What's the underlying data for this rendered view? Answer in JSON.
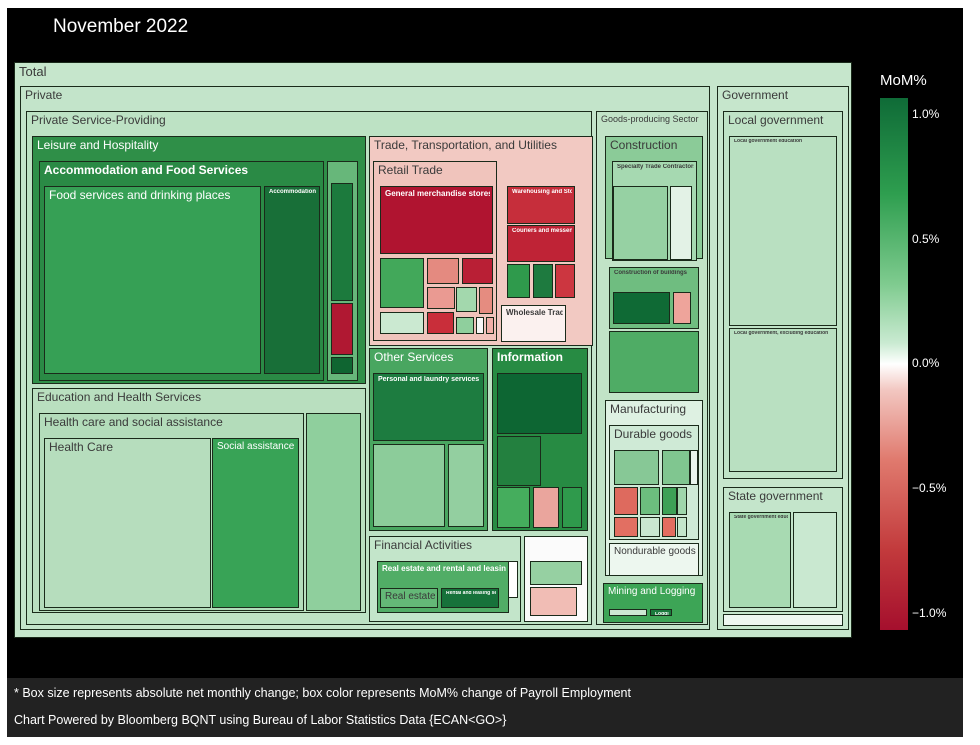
{
  "title": "November 2022",
  "colorbar": {
    "title": "MoM%",
    "ticks": [
      "1.0%",
      "0.5%",
      "0.0%",
      "−0.5%",
      "−1.0%"
    ]
  },
  "footer": {
    "line1": "* Box size represents absolute net monthly change; box color represents MoM% change of Payroll Employment",
    "line2": "Chart Powered by Bloomberg BQNT using Bureau of Labor Statistics Data {ECAN<GO>}"
  },
  "chart_data": {
    "type": "treemap",
    "size_measure": "absolute net monthly change",
    "color_measure": "MoM% change of Payroll Employment",
    "color_range": [
      -1.0,
      1.0
    ],
    "nodes": [
      {
        "label": "Total",
        "color": "#c6e6cc"
      },
      {
        "label": "Private",
        "color": "#c3e4ca"
      },
      {
        "label": "Private Service-Providing",
        "color": "#bde2c4"
      },
      {
        "label": "Leisure and Hospitality",
        "color": "#2f8f48"
      },
      {
        "label": "Accommodation and Food Services",
        "color": "#2a8a45"
      },
      {
        "label": "Food services and drinking places",
        "color": "#36a055"
      },
      {
        "label": "Accommodation",
        "color": "#186f38"
      },
      {
        "label": "",
        "color": "#67b77a"
      },
      {
        "label": "",
        "color": "#1c7a3d"
      },
      {
        "label": "",
        "color": "#b01832"
      },
      {
        "label": "",
        "color": "#0f6531"
      },
      {
        "label": "Education and Health Services",
        "color": "#b9dfbf"
      },
      {
        "label": "Health care and social assistance",
        "color": "#b3dcba"
      },
      {
        "label": "Health Care",
        "color": "#b6ddbd"
      },
      {
        "label": "Social assistance",
        "color": "#38a356"
      },
      {
        "label": "",
        "color": "#8fcf9d"
      },
      {
        "label": "Trade, Transportation, and Utilities",
        "color": "#f2c9c2"
      },
      {
        "label": "Retail Trade",
        "color": "#f0c4bc"
      },
      {
        "label": "General merchandise stores",
        "color": "#b01430"
      },
      {
        "label": "",
        "color": "#42a85a"
      },
      {
        "label": "",
        "color": "#e48a80"
      },
      {
        "label": "",
        "color": "#b91f35"
      },
      {
        "label": "",
        "color": "#ea9a92"
      },
      {
        "label": "",
        "color": "#a3d8ad"
      },
      {
        "label": "",
        "color": "#e58c80"
      },
      {
        "label": "",
        "color": "#cbe9d1"
      },
      {
        "label": "",
        "color": "#c92e3a"
      },
      {
        "label": "",
        "color": "#8fcf9d"
      },
      {
        "label": "",
        "color": "#f7f7f7"
      },
      {
        "label": "",
        "color": "#f0b0a8"
      },
      {
        "label": "Warehousing and Storage",
        "color": "#c62e3b"
      },
      {
        "label": "Couriers and messengers",
        "color": "#bf2336"
      },
      {
        "label": "",
        "color": "#2f9a4c"
      },
      {
        "label": "",
        "color": "#1e7a3f"
      },
      {
        "label": "",
        "color": "#cc3640"
      },
      {
        "label": "Wholesale Trade",
        "color": "#fbf1ef"
      },
      {
        "label": "Other Services",
        "color": "#49a660"
      },
      {
        "label": "Personal and laundry services",
        "color": "#1d7c40"
      },
      {
        "label": "",
        "color": "#8ccc9a"
      },
      {
        "label": "",
        "color": "#93cfa0"
      },
      {
        "label": "Information",
        "color": "#278b43"
      },
      {
        "label": "",
        "color": "#0d6633"
      },
      {
        "label": "",
        "color": "#23803f"
      },
      {
        "label": "",
        "color": "#45ad5d"
      },
      {
        "label": "",
        "color": "#5bb36f"
      },
      {
        "label": "",
        "color": "#eaa59d"
      },
      {
        "label": "",
        "color": "#2f9a4c"
      },
      {
        "label": "Financial Activities",
        "color": "#c3e5ca"
      },
      {
        "label": "Real estate and rental and leasing",
        "color": "#51ad66"
      },
      {
        "label": "Real estate",
        "color": "#64b877"
      },
      {
        "label": "Rental and leasing services",
        "color": "#17723a"
      },
      {
        "label": "",
        "color": "#ffffff"
      },
      {
        "label": "",
        "color": "#fbfbfb"
      },
      {
        "label": "",
        "color": "#96d0a2"
      },
      {
        "label": "",
        "color": "#f1bdb5"
      },
      {
        "label": "Goods-producing Sector",
        "color": "#c1e3c7"
      },
      {
        "label": "Construction",
        "color": "#8bcb98"
      },
      {
        "label": "Specialty Trade Contractors",
        "color": "#a6d9b1"
      },
      {
        "label": "",
        "color": "#96d1a3"
      },
      {
        "label": "",
        "color": "#e3f2e6"
      },
      {
        "label": "Construction of buildings",
        "color": "#6fbd80"
      },
      {
        "label": "",
        "color": "#0f6a35"
      },
      {
        "label": "",
        "color": "#eea49b"
      },
      {
        "label": "",
        "color": "#4fac65"
      },
      {
        "label": "Manufacturing",
        "color": "#def1e2"
      },
      {
        "label": "Durable goods",
        "color": "#cfead6"
      },
      {
        "label": "",
        "color": "#87c896"
      },
      {
        "label": "",
        "color": "#80c690"
      },
      {
        "label": "",
        "color": "#de6a5e"
      },
      {
        "label": "",
        "color": "#6cbd7e"
      },
      {
        "label": "",
        "color": "#3da156"
      },
      {
        "label": "",
        "color": "#e26f62"
      },
      {
        "label": "",
        "color": "#c9e7d0"
      },
      {
        "label": "",
        "color": "#e36d60"
      },
      {
        "label": "",
        "color": "#c4e6cb"
      },
      {
        "label": "",
        "color": "#9fd6ab"
      },
      {
        "label": "",
        "color": "#e9f5ec"
      },
      {
        "label": "Nondurable goods",
        "color": "#edf7ef"
      },
      {
        "label": "Mining and Logging",
        "color": "#3da556"
      },
      {
        "label": "",
        "color": "#cbe8d1"
      },
      {
        "label": "Logging",
        "color": "#1b7a3d"
      },
      {
        "label": "Government",
        "color": "#c6e6cc"
      },
      {
        "label": "Local government",
        "color": "#bfe3c6"
      },
      {
        "label": "Local government education",
        "color": "#b9e0c1"
      },
      {
        "label": "Local government, excluding education",
        "color": "#b9e0c1"
      },
      {
        "label": "State government",
        "color": "#c4e5cb"
      },
      {
        "label": "State government education",
        "color": "#a8dab2"
      },
      {
        "label": "",
        "color": "#c9e8d0"
      },
      {
        "label": "",
        "color": "#eef7f0"
      }
    ]
  }
}
